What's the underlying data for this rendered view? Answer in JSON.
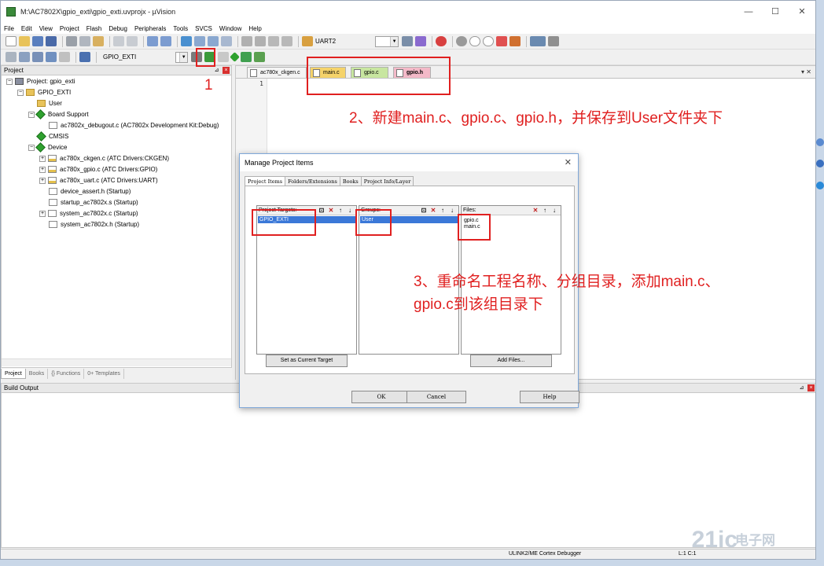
{
  "window": {
    "title": "M:\\AC7802X\\gpio_exti\\gpio_exti.uvprojx - µVision",
    "minimize": "—",
    "maximize": "☐",
    "close": "✕"
  },
  "menu": [
    "File",
    "Edit",
    "View",
    "Project",
    "Flash",
    "Debug",
    "Peripherals",
    "Tools",
    "SVCS",
    "Window",
    "Help"
  ],
  "toolbar1": {
    "combo_value": "UART2"
  },
  "toolbar2": {
    "target_value": "GPIO_EXTI"
  },
  "project_panel": {
    "header": "Project",
    "root": "Project: gpio_exti",
    "target": "GPIO_EXTI",
    "items": [
      "User",
      "Board Support",
      "ac7802x_debugout.c (AC7802x Development Kit:Debug)",
      "CMSIS",
      "Device",
      "ac780x_ckgen.c (ATC Drivers:CKGEN)",
      "ac780x_gpio.c (ATC Drivers:GPIO)",
      "ac780x_uart.c (ATC Drivers:UART)",
      "device_assert.h (Startup)",
      "startup_ac7802x.s (Startup)",
      "system_ac7802x.c (Startup)",
      "system_ac7802x.h (Startup)"
    ],
    "tabs": [
      "Project",
      "Books",
      "{} Functions",
      "0+ Templates"
    ]
  },
  "editor": {
    "tabs": [
      "ac780x_ckgen.c",
      "main.c",
      "gpio.c",
      "gpio.h"
    ],
    "line_number": "1",
    "tab_tools": "▾  ✕"
  },
  "dialog": {
    "title": "Manage Project Items",
    "close": "✕",
    "tabs": [
      "Project Items",
      "Folders/Extensions",
      "Books",
      "Project Info/Layer"
    ],
    "targets_label": "Project Targets:",
    "targets": [
      "GPIO_EXTI"
    ],
    "groups_label": "Groups:",
    "groups": [
      "User"
    ],
    "files_label": "Files:",
    "files": [
      "gpio.c",
      "main.c"
    ],
    "set_current_target": "Set as Current Target",
    "add_files": "Add Files...",
    "ok": "OK",
    "cancel": "Cancel",
    "help": "Help"
  },
  "build_output": {
    "header": "Build Output"
  },
  "status_bar": {
    "debugger": "ULINK2/ME Cortex Debugger",
    "position": "L:1 C:1"
  },
  "annotations": {
    "step1": "1",
    "step2": "2、新建main.c、gpio.c、gpio.h，并保存到User文件夹下",
    "step3_line1": "3、重命名工程名称、分组目录，添加main.c、",
    "step3_line2": "gpio.c到该组目录下"
  },
  "watermark": {
    "brand": "21ic",
    "cn": "电子网"
  },
  "colors": {
    "annotation_red": "#e02020",
    "selection_blue": "#3b78d8",
    "main_tab": "#f5d36a",
    "gpio_tab": "#c8e6a0",
    "gpioh_tab": "#f3b9c8"
  }
}
